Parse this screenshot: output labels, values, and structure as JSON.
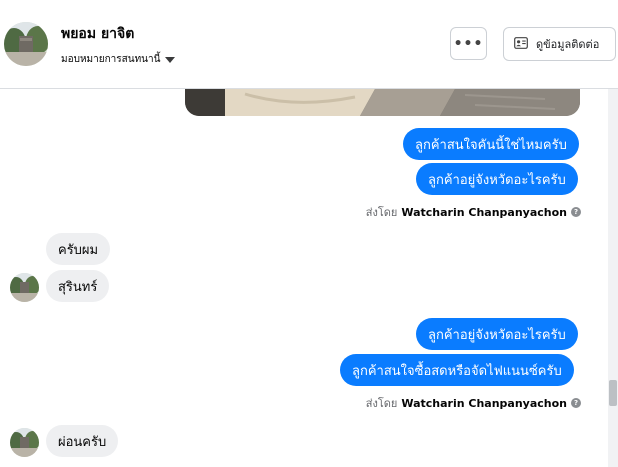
{
  "header": {
    "name": "พยอม ยาจิต",
    "assign_label": "มอบหมายการสนทนานี้",
    "more_label": "•••",
    "info_label": "ดูข้อมูลติดต่อ"
  },
  "messages": {
    "out1": "ลูกค้าสนใจคันนี้ใช่ไหมครับ",
    "out2": "ลูกค้าอยู่จังหวัดอะไรครับ",
    "in1": "ครับผม",
    "in2": "สุรินทร์",
    "out3": "ลูกค้าอยู่จังหวัดอะไรครับ",
    "out4": "ลูกค้าสนใจซื้อสดหรือจัดไฟแนนซ์ครับ",
    "in3": "ผ่อนครับ"
  },
  "sent_by": {
    "prefix": "ส่งโดย",
    "sender": "Watcharin Chanpanyachon",
    "help": "?"
  },
  "colors": {
    "outgoing": "#0a7cff",
    "incoming": "#eeeff1",
    "border": "#dadde1"
  }
}
